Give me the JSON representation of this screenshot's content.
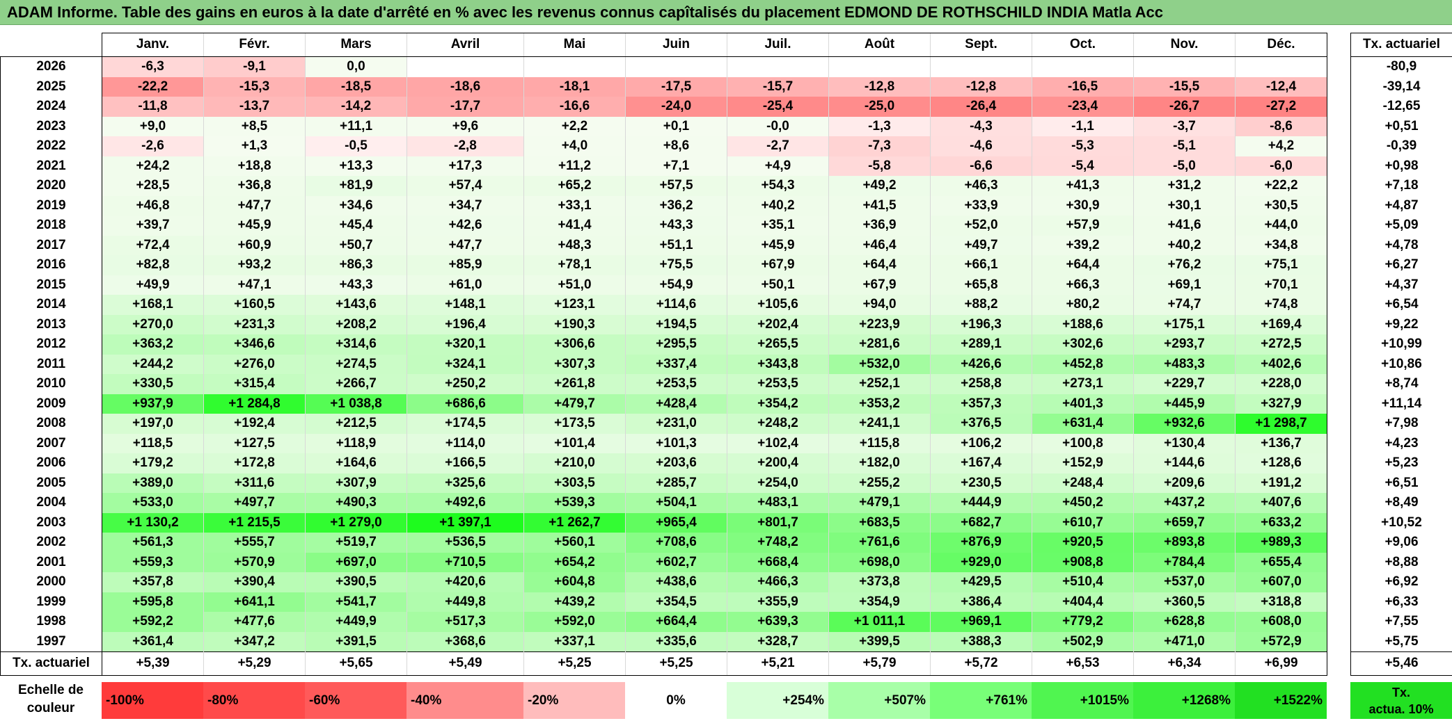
{
  "title": "ADAM Informe. Table des gains en euros à la date d'arrêté en % avec les revenus connus capîtalisés du placement EDMOND DE ROTHSCHILD INDIA Matla Acc",
  "months": [
    "Janv.",
    "Févr.",
    "Mars",
    "Avril",
    "Mai",
    "Juin",
    "Juil.",
    "Août",
    "Sept.",
    "Oct.",
    "Nov.",
    "Déc."
  ],
  "side_header": "Tx. actuariel",
  "rows": [
    {
      "year": "2026",
      "values": [
        "-6,3",
        "-9,1",
        "0,0",
        "",
        "",
        "",
        "",
        "",
        "",
        "",
        "",
        ""
      ],
      "rate": "-80,9"
    },
    {
      "year": "2025",
      "values": [
        "-22,2",
        "-15,3",
        "-18,5",
        "-18,6",
        "-18,1",
        "-17,5",
        "-15,7",
        "-12,8",
        "-12,8",
        "-16,5",
        "-15,5",
        "-12,4"
      ],
      "rate": "-39,14"
    },
    {
      "year": "2024",
      "values": [
        "-11,8",
        "-13,7",
        "-14,2",
        "-17,7",
        "-16,6",
        "-24,0",
        "-25,4",
        "-25,0",
        "-26,4",
        "-23,4",
        "-26,7",
        "-27,2"
      ],
      "rate": "-12,65"
    },
    {
      "year": "2023",
      "values": [
        "+9,0",
        "+8,5",
        "+11,1",
        "+9,6",
        "+2,2",
        "+0,1",
        "-0,0",
        "-1,3",
        "-4,3",
        "-1,1",
        "-3,7",
        "-8,6"
      ],
      "rate": "+0,51"
    },
    {
      "year": "2022",
      "values": [
        "-2,6",
        "+1,3",
        "-0,5",
        "-2,8",
        "+4,0",
        "+8,6",
        "-2,7",
        "-7,3",
        "-4,6",
        "-5,3",
        "-5,1",
        "+4,2"
      ],
      "rate": "-0,39"
    },
    {
      "year": "2021",
      "values": [
        "+24,2",
        "+18,8",
        "+13,3",
        "+17,3",
        "+11,2",
        "+7,1",
        "+4,9",
        "-5,8",
        "-6,6",
        "-5,4",
        "-5,0",
        "-6,0"
      ],
      "rate": "+0,98"
    },
    {
      "year": "2020",
      "values": [
        "+28,5",
        "+36,8",
        "+81,9",
        "+57,4",
        "+65,2",
        "+57,5",
        "+54,3",
        "+49,2",
        "+46,3",
        "+41,3",
        "+31,2",
        "+22,2"
      ],
      "rate": "+7,18"
    },
    {
      "year": "2019",
      "values": [
        "+46,8",
        "+47,7",
        "+34,6",
        "+34,7",
        "+33,1",
        "+36,2",
        "+40,2",
        "+41,5",
        "+33,9",
        "+30,9",
        "+30,1",
        "+30,5"
      ],
      "rate": "+4,87"
    },
    {
      "year": "2018",
      "values": [
        "+39,7",
        "+45,9",
        "+45,4",
        "+42,6",
        "+41,4",
        "+43,3",
        "+35,1",
        "+36,9",
        "+52,0",
        "+57,9",
        "+41,6",
        "+44,0"
      ],
      "rate": "+5,09"
    },
    {
      "year": "2017",
      "values": [
        "+72,4",
        "+60,9",
        "+50,7",
        "+47,7",
        "+48,3",
        "+51,1",
        "+45,9",
        "+46,4",
        "+49,7",
        "+39,2",
        "+40,2",
        "+34,8"
      ],
      "rate": "+4,78"
    },
    {
      "year": "2016",
      "values": [
        "+82,8",
        "+93,2",
        "+86,3",
        "+85,9",
        "+78,1",
        "+75,5",
        "+67,9",
        "+64,4",
        "+66,1",
        "+64,4",
        "+76,2",
        "+75,1"
      ],
      "rate": "+6,27"
    },
    {
      "year": "2015",
      "values": [
        "+49,9",
        "+47,1",
        "+43,3",
        "+61,0",
        "+51,0",
        "+54,9",
        "+50,1",
        "+67,9",
        "+65,8",
        "+66,3",
        "+69,1",
        "+70,1"
      ],
      "rate": "+4,37"
    },
    {
      "year": "2014",
      "values": [
        "+168,1",
        "+160,5",
        "+143,6",
        "+148,1",
        "+123,1",
        "+114,6",
        "+105,6",
        "+94,0",
        "+88,2",
        "+80,2",
        "+74,7",
        "+74,8"
      ],
      "rate": "+6,54"
    },
    {
      "year": "2013",
      "values": [
        "+270,0",
        "+231,3",
        "+208,2",
        "+196,4",
        "+190,3",
        "+194,5",
        "+202,4",
        "+223,9",
        "+196,3",
        "+188,6",
        "+175,1",
        "+169,4"
      ],
      "rate": "+9,22"
    },
    {
      "year": "2012",
      "values": [
        "+363,2",
        "+346,6",
        "+314,6",
        "+320,1",
        "+306,6",
        "+295,5",
        "+265,5",
        "+281,6",
        "+289,1",
        "+302,6",
        "+293,7",
        "+272,5"
      ],
      "rate": "+10,99"
    },
    {
      "year": "2011",
      "values": [
        "+244,2",
        "+276,0",
        "+274,5",
        "+324,1",
        "+307,3",
        "+337,4",
        "+343,8",
        "+532,0",
        "+426,6",
        "+452,8",
        "+483,3",
        "+402,6"
      ],
      "rate": "+10,86"
    },
    {
      "year": "2010",
      "values": [
        "+330,5",
        "+315,4",
        "+266,7",
        "+250,2",
        "+261,8",
        "+253,5",
        "+253,5",
        "+252,1",
        "+258,8",
        "+273,1",
        "+229,7",
        "+228,0"
      ],
      "rate": "+8,74"
    },
    {
      "year": "2009",
      "values": [
        "+937,9",
        "+1 284,8",
        "+1 038,8",
        "+686,6",
        "+479,7",
        "+428,4",
        "+354,2",
        "+353,2",
        "+357,3",
        "+401,3",
        "+445,9",
        "+327,9"
      ],
      "rate": "+11,14"
    },
    {
      "year": "2008",
      "values": [
        "+197,0",
        "+192,4",
        "+212,5",
        "+174,5",
        "+173,5",
        "+231,0",
        "+248,2",
        "+241,1",
        "+376,5",
        "+631,4",
        "+932,6",
        "+1 298,7"
      ],
      "rate": "+7,98"
    },
    {
      "year": "2007",
      "values": [
        "+118,5",
        "+127,5",
        "+118,9",
        "+114,0",
        "+101,4",
        "+101,3",
        "+102,4",
        "+115,8",
        "+106,2",
        "+100,8",
        "+130,4",
        "+136,7"
      ],
      "rate": "+4,23"
    },
    {
      "year": "2006",
      "values": [
        "+179,2",
        "+172,8",
        "+164,6",
        "+166,5",
        "+210,0",
        "+203,6",
        "+200,4",
        "+182,0",
        "+167,4",
        "+152,9",
        "+144,6",
        "+128,6"
      ],
      "rate": "+5,23"
    },
    {
      "year": "2005",
      "values": [
        "+389,0",
        "+311,6",
        "+307,9",
        "+325,6",
        "+303,5",
        "+285,7",
        "+254,0",
        "+255,2",
        "+230,5",
        "+248,4",
        "+209,6",
        "+191,2"
      ],
      "rate": "+6,51"
    },
    {
      "year": "2004",
      "values": [
        "+533,0",
        "+497,7",
        "+490,3",
        "+492,6",
        "+539,3",
        "+504,1",
        "+483,1",
        "+479,1",
        "+444,9",
        "+450,2",
        "+437,2",
        "+407,6"
      ],
      "rate": "+8,49"
    },
    {
      "year": "2003",
      "values": [
        "+1 130,2",
        "+1 215,5",
        "+1 279,0",
        "+1 397,1",
        "+1 262,7",
        "+965,4",
        "+801,7",
        "+683,5",
        "+682,7",
        "+610,7",
        "+659,7",
        "+633,2"
      ],
      "rate": "+10,52"
    },
    {
      "year": "2002",
      "values": [
        "+561,3",
        "+555,7",
        "+519,7",
        "+536,5",
        "+560,1",
        "+708,6",
        "+748,2",
        "+761,6",
        "+876,9",
        "+920,5",
        "+893,8",
        "+989,3"
      ],
      "rate": "+9,06"
    },
    {
      "year": "2001",
      "values": [
        "+559,3",
        "+570,9",
        "+697,0",
        "+710,5",
        "+654,2",
        "+602,7",
        "+668,4",
        "+698,0",
        "+929,0",
        "+908,8",
        "+784,4",
        "+655,4"
      ],
      "rate": "+8,88"
    },
    {
      "year": "2000",
      "values": [
        "+357,8",
        "+390,4",
        "+390,5",
        "+420,6",
        "+604,8",
        "+438,6",
        "+466,3",
        "+373,8",
        "+429,5",
        "+510,4",
        "+537,0",
        "+607,0"
      ],
      "rate": "+6,92"
    },
    {
      "year": "1999",
      "values": [
        "+595,8",
        "+641,1",
        "+541,7",
        "+449,8",
        "+439,2",
        "+354,5",
        "+355,9",
        "+354,9",
        "+386,4",
        "+404,4",
        "+360,5",
        "+318,8"
      ],
      "rate": "+6,33"
    },
    {
      "year": "1998",
      "values": [
        "+592,2",
        "+477,6",
        "+449,9",
        "+517,3",
        "+592,0",
        "+664,4",
        "+639,3",
        "+1 011,1",
        "+969,1",
        "+779,2",
        "+628,8",
        "+608,0"
      ],
      "rate": "+7,55"
    },
    {
      "year": "1997",
      "values": [
        "+361,4",
        "+347,2",
        "+391,5",
        "+368,6",
        "+337,1",
        "+335,6",
        "+328,7",
        "+399,5",
        "+388,3",
        "+502,9",
        "+471,0",
        "+572,9"
      ],
      "rate": "+5,75"
    }
  ],
  "footer": {
    "label": "Tx. actuariel",
    "values": [
      "+5,39",
      "+5,29",
      "+5,65",
      "+5,49",
      "+5,25",
      "+5,25",
      "+5,21",
      "+5,79",
      "+5,72",
      "+6,53",
      "+6,34",
      "+6,99"
    ],
    "rate": "+5,46"
  },
  "scale": {
    "label_line1": "Echelle de",
    "label_line2": "couleur",
    "cells": [
      {
        "text": "-100%",
        "color": "#ff3b3b",
        "align": "left"
      },
      {
        "text": "-80%",
        "color": "#ff4a4a",
        "align": "left"
      },
      {
        "text": "-60%",
        "color": "#ff5a5a",
        "align": "left"
      },
      {
        "text": "-40%",
        "color": "#ff8c8c",
        "align": "left"
      },
      {
        "text": "-20%",
        "color": "#ffbcbc",
        "align": "left"
      },
      {
        "text": "0%",
        "color": "#ffffff",
        "align": "center"
      },
      {
        "text": "+254%",
        "color": "#d8ffd8",
        "align": "right"
      },
      {
        "text": "+507%",
        "color": "#a8ffa8",
        "align": "right"
      },
      {
        "text": "+761%",
        "color": "#78ff78",
        "align": "right"
      },
      {
        "text": "+1015%",
        "color": "#50f550",
        "align": "right"
      },
      {
        "text": "+1268%",
        "color": "#3cf03c",
        "align": "right"
      },
      {
        "text": "+1522%",
        "color": "#22e022",
        "align": "right"
      }
    ],
    "side_line1": "Tx.",
    "side_line2": "actua. 10%"
  },
  "colors": {
    "title_bg": "#8fd08a",
    "negative_max": "#ff3b3b",
    "positive_max": "#22e022"
  }
}
